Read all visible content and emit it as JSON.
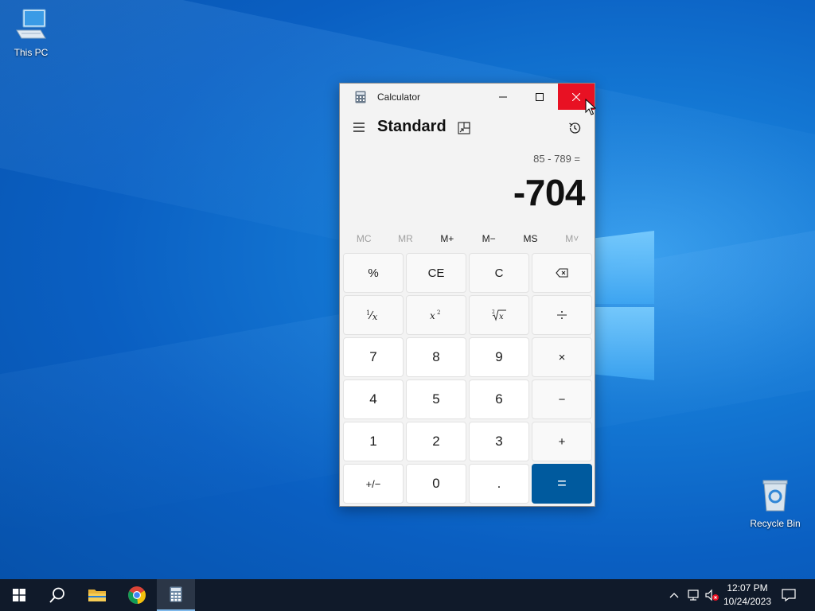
{
  "desktop": {
    "icons": [
      {
        "label": "This PC"
      },
      {
        "label": "Recycle Bin"
      }
    ]
  },
  "window": {
    "title": "Calculator",
    "controls": {
      "minimize": "minimize",
      "maximize": "maximize",
      "close": "close"
    }
  },
  "calculator": {
    "mode": "Standard",
    "expression": "85 - 789 =",
    "result": "-704",
    "memory": [
      "MC",
      "MR",
      "M+",
      "M−",
      "MS",
      "M˅"
    ],
    "keys": {
      "percent": "%",
      "ce": "CE",
      "c": "C",
      "seven": "7",
      "eight": "8",
      "nine": "9",
      "times": "×",
      "four": "4",
      "five": "5",
      "six": "6",
      "minus": "−",
      "one": "1",
      "two": "2",
      "three": "3",
      "plus": "+",
      "negate": "+/−",
      "zero": "0",
      "decimal": ".",
      "equals": "="
    }
  },
  "taskbar": {
    "clock_time": "12:07 PM",
    "clock_date": "10/24/2023"
  },
  "colors": {
    "accent": "#005a9e",
    "close_hover": "#e81123",
    "taskbar": "#101a2a"
  }
}
